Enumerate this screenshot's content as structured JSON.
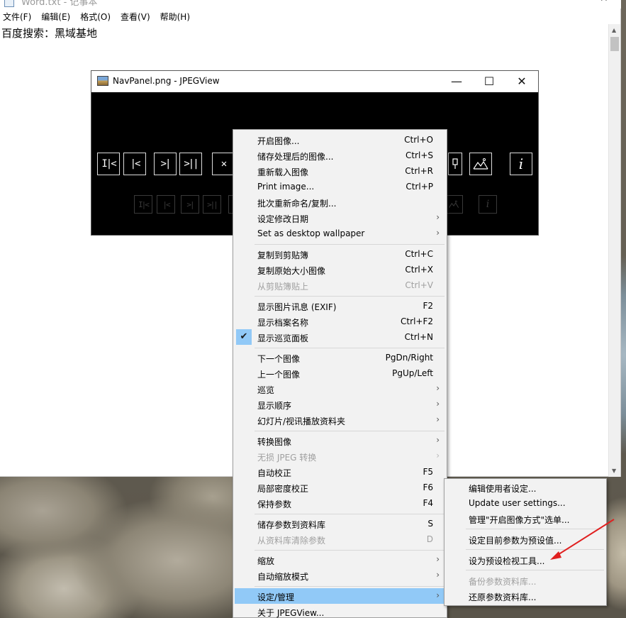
{
  "notepad": {
    "title": "Word.txt - 记事本",
    "menu": [
      "文件(F)",
      "编辑(E)",
      "格式(O)",
      "查看(V)",
      "帮助(H)"
    ],
    "content": "百度搜索：黑域基地"
  },
  "jpegview": {
    "title": "NavPanel.png - JPEGView",
    "window_controls": {
      "minimize": "—",
      "maximize": "☐",
      "close": "✕"
    },
    "nav_buttons": [
      "I|<",
      "|<",
      ">|",
      ">||",
      "✕"
    ],
    "right_buttons": [
      "i"
    ]
  },
  "context_menu": {
    "items": [
      {
        "label": "开启图像...",
        "shortcut": "Ctrl+O"
      },
      {
        "label": "储存处理后的图像...",
        "shortcut": "Ctrl+S"
      },
      {
        "label": "重新载入图像",
        "shortcut": "Ctrl+R"
      },
      {
        "label": "Print image...",
        "shortcut": "Ctrl+P"
      },
      {
        "label": "批次重新命名/复制...",
        "shortcut": ""
      },
      {
        "label": "设定修改日期",
        "shortcut": "",
        "submenu": true
      },
      {
        "label": "Set as desktop wallpaper",
        "shortcut": "",
        "submenu": true
      },
      {
        "label": "复制到剪贴簿",
        "shortcut": "Ctrl+C"
      },
      {
        "label": "复制原始大小图像",
        "shortcut": "Ctrl+X"
      },
      {
        "label": "从剪贴簿贴上",
        "shortcut": "Ctrl+V",
        "disabled": true
      },
      {
        "label": "显示图片讯息 (EXIF)",
        "shortcut": "F2"
      },
      {
        "label": "显示档案名称",
        "shortcut": "Ctrl+F2"
      },
      {
        "label": "显示巡览面板",
        "shortcut": "Ctrl+N",
        "checked": true
      },
      {
        "label": "下一个图像",
        "shortcut": "PgDn/Right"
      },
      {
        "label": "上一个图像",
        "shortcut": "PgUp/Left"
      },
      {
        "label": "巡览",
        "shortcut": "",
        "submenu": true
      },
      {
        "label": "显示顺序",
        "shortcut": "",
        "submenu": true
      },
      {
        "label": "幻灯片/视讯播放资料夹",
        "shortcut": "",
        "submenu": true
      },
      {
        "label": "转换图像",
        "shortcut": "",
        "submenu": true
      },
      {
        "label": "无损 JPEG 转换",
        "shortcut": "",
        "submenu": true,
        "disabled": true
      },
      {
        "label": "自动校正",
        "shortcut": "F5"
      },
      {
        "label": "局部密度校正",
        "shortcut": "F6"
      },
      {
        "label": "保持参数",
        "shortcut": "F4"
      },
      {
        "label": "储存参数到资料库",
        "shortcut": "S"
      },
      {
        "label": "从资料库清除参数",
        "shortcut": "D",
        "disabled": true
      },
      {
        "label": "缩放",
        "shortcut": "",
        "submenu": true
      },
      {
        "label": "自动缩放模式",
        "shortcut": "",
        "submenu": true
      },
      {
        "label": "设定/管理",
        "shortcut": "",
        "submenu": true,
        "highlighted": true
      },
      {
        "label": "关于 JPEGView...",
        "shortcut": ""
      }
    ]
  },
  "submenu": {
    "items": [
      {
        "label": "编辑使用者设定..."
      },
      {
        "label": "Update user settings..."
      },
      {
        "label": "管理\"开启图像方式\"选单..."
      },
      {
        "label": "设定目前参数为预设值..."
      },
      {
        "label": "设为预设检视工具..."
      },
      {
        "label": "备份参数资料库...",
        "disabled": true
      },
      {
        "label": "还原参数资料库..."
      }
    ]
  },
  "colors": {
    "menu_highlight": "#91c9f7",
    "annotation_arrow": "#e02020"
  },
  "icons": {
    "check": "✔",
    "submenu_arrow": "›"
  }
}
